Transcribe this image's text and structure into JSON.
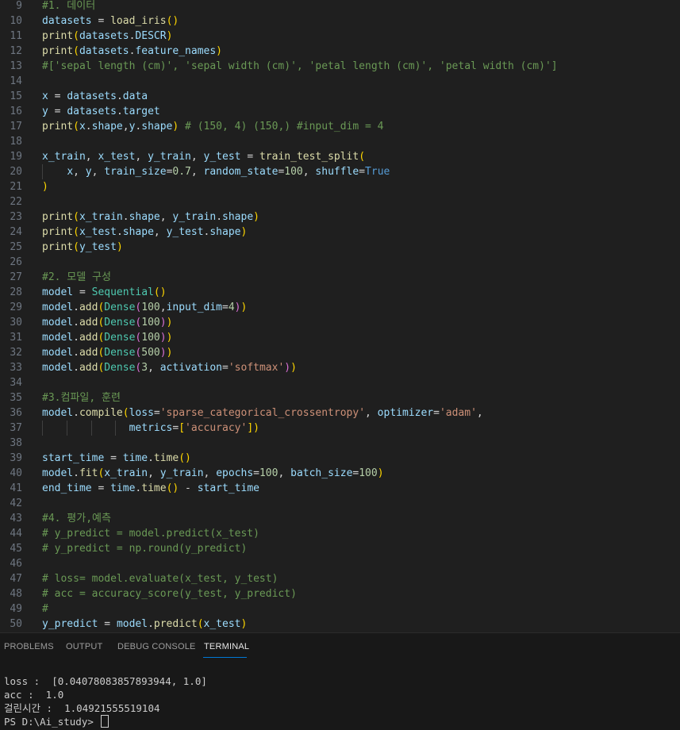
{
  "editor": {
    "lines": [
      {
        "n": "9",
        "text": "#1. 데이터"
      },
      {
        "n": "10",
        "text": "datasets = load_iris()"
      },
      {
        "n": "11",
        "text": "print(datasets.DESCR)"
      },
      {
        "n": "12",
        "text": "print(datasets.feature_names)"
      },
      {
        "n": "13",
        "text": "#['sepal length (cm)', 'sepal width (cm)', 'petal length (cm)', 'petal width (cm)']"
      },
      {
        "n": "14",
        "text": ""
      },
      {
        "n": "15",
        "text": "x = datasets.data"
      },
      {
        "n": "16",
        "text": "y = datasets.target"
      },
      {
        "n": "17",
        "text": "print(x.shape,y.shape) # (150, 4) (150,) #input_dim = 4"
      },
      {
        "n": "18",
        "text": ""
      },
      {
        "n": "19",
        "text": "x_train, x_test, y_train, y_test = train_test_split("
      },
      {
        "n": "20",
        "text": "    x, y, train_size=0.7, random_state=100, shuffle=True"
      },
      {
        "n": "21",
        "text": ")"
      },
      {
        "n": "22",
        "text": ""
      },
      {
        "n": "23",
        "text": "print(x_train.shape, y_train.shape)"
      },
      {
        "n": "24",
        "text": "print(x_test.shape, y_test.shape)"
      },
      {
        "n": "25",
        "text": "print(y_test)"
      },
      {
        "n": "26",
        "text": ""
      },
      {
        "n": "27",
        "text": "#2. 모델 구성"
      },
      {
        "n": "28",
        "text": "model = Sequential()"
      },
      {
        "n": "29",
        "text": "model.add(Dense(100,input_dim=4))"
      },
      {
        "n": "30",
        "text": "model.add(Dense(100))"
      },
      {
        "n": "31",
        "text": "model.add(Dense(100))"
      },
      {
        "n": "32",
        "text": "model.add(Dense(500))"
      },
      {
        "n": "33",
        "text": "model.add(Dense(3, activation='softmax'))"
      },
      {
        "n": "34",
        "text": ""
      },
      {
        "n": "35",
        "text": "#3.컴파일, 훈련"
      },
      {
        "n": "36",
        "text": "model.compile(loss='sparse_categorical_crossentropy', optimizer='adam',"
      },
      {
        "n": "37",
        "text": "              metrics=['accuracy'])"
      },
      {
        "n": "38",
        "text": ""
      },
      {
        "n": "39",
        "text": "start_time = time.time()"
      },
      {
        "n": "40",
        "text": "model.fit(x_train, y_train, epochs=100, batch_size=100)"
      },
      {
        "n": "41",
        "text": "end_time = time.time() - start_time"
      },
      {
        "n": "42",
        "text": ""
      },
      {
        "n": "43",
        "text": "#4. 평가,예측"
      },
      {
        "n": "44",
        "text": "# y_predict = model.predict(x_test)"
      },
      {
        "n": "45",
        "text": "# y_predict = np.round(y_predict)"
      },
      {
        "n": "46",
        "text": ""
      },
      {
        "n": "47",
        "text": "# loss= model.evaluate(x_test, y_test)"
      },
      {
        "n": "48",
        "text": "# acc = accuracy_score(y_test, y_predict)"
      },
      {
        "n": "49",
        "text": "#"
      },
      {
        "n": "50",
        "text": "y_predict = model.predict(x_test)"
      }
    ]
  },
  "panel": {
    "tabs": [
      {
        "label": "PROBLEMS",
        "active": false
      },
      {
        "label": "OUTPUT",
        "active": false
      },
      {
        "label": "DEBUG CONSOLE",
        "active": false
      },
      {
        "label": "TERMINAL",
        "active": true
      }
    ],
    "accent_color": "#0078d4"
  },
  "terminal": {
    "lines": [
      "loss :  [0.04078083857893944, 1.0]",
      "acc :  1.0",
      "걸린시간 :  1.04921555519104"
    ],
    "prompt": "PS D:\\Ai_study> "
  }
}
